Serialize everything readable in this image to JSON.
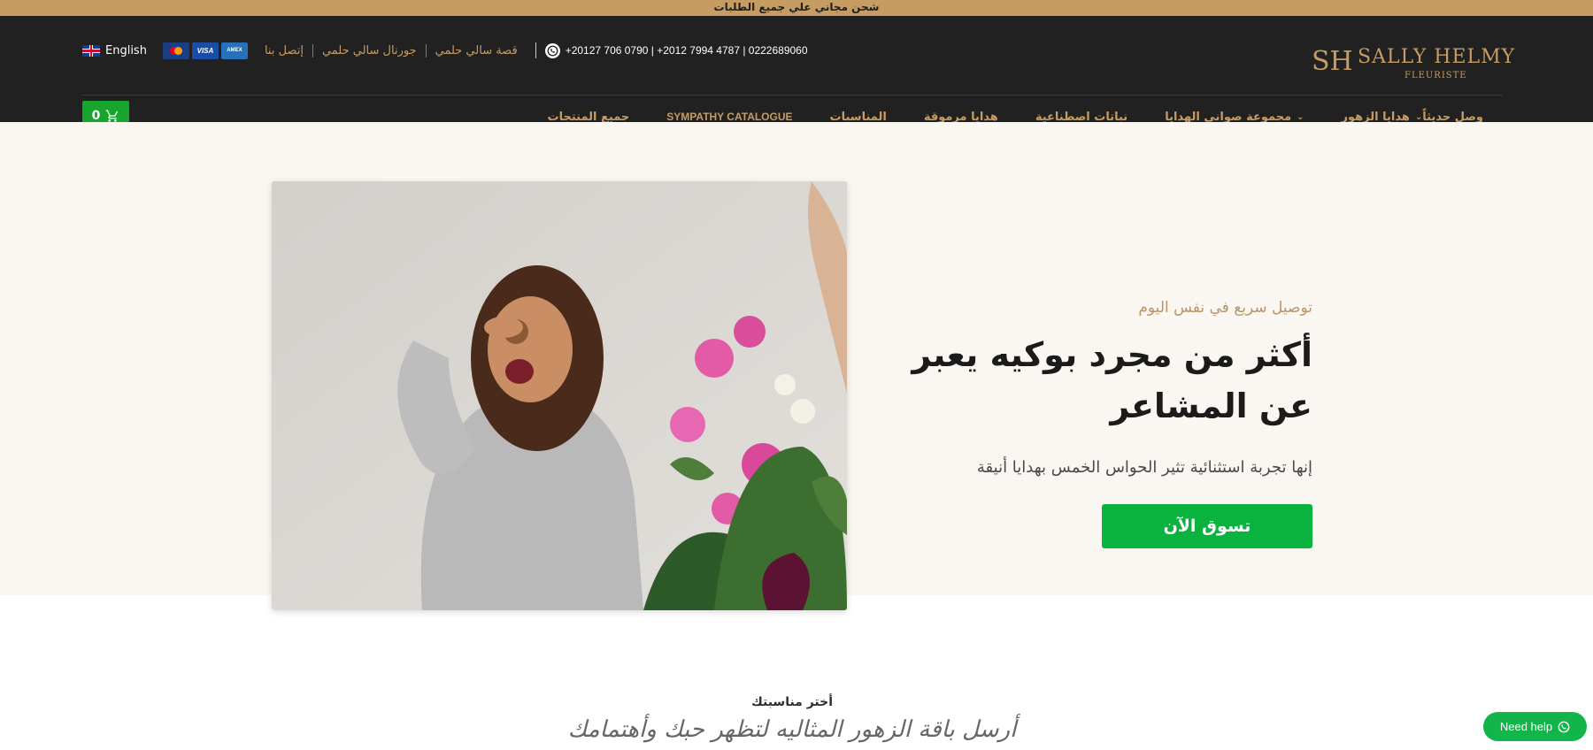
{
  "announcement": "شحن مجاني علي جميع الطلبات",
  "header": {
    "language": "English",
    "payment_icons": [
      "mastercard-icon",
      "visa-icon",
      "amex-icon"
    ],
    "visa_label": "VISA",
    "amex_label": "AMERICAN EXPRESS",
    "links": [
      "إتصل بنا",
      "جورنال سالي حلمي",
      "قصة سالي حلمي"
    ],
    "phones": "+20127 706 0790 | +2012 7994 4787 | 0222689060",
    "logo": {
      "mark": "SH",
      "name": "SALLY HELMY",
      "sub": "FLEURISTE"
    },
    "cart_count": "0"
  },
  "nav": [
    {
      "label": "وصل حديثاً",
      "dropdown": false
    },
    {
      "label": "هدايا الزهور",
      "dropdown": true
    },
    {
      "label": "مجموعة صواني الهدايا",
      "dropdown": true
    },
    {
      "label": "نباتات اصطناعية",
      "dropdown": false
    },
    {
      "label": "هدايا مرموقة",
      "dropdown": false
    },
    {
      "label": "المناسبات",
      "dropdown": false
    },
    {
      "label": "SYMPATHY CATALOGUE",
      "dropdown": false
    },
    {
      "label": "جميع المنتجات",
      "dropdown": false
    }
  ],
  "hero": {
    "kicker": "توصيل سريع في نفس اليوم",
    "headline": "أكثر من مجرد بوكيه يعبر عن المشاعر",
    "subtext": "إنها تجربة استثنائية تثير الحواس الخمس بهدايا أنيقة",
    "cta": "تسوق الآن"
  },
  "section": {
    "label": "أختر مناسبتك",
    "title": "أرسل باقة الزهور المثاليه لتظهر حبك وأهتمامك"
  },
  "help_button": "Need help",
  "colors": {
    "gold": "#c79c63",
    "dark": "#212121",
    "green": "#0ab33e",
    "cream": "#faf6f1"
  }
}
